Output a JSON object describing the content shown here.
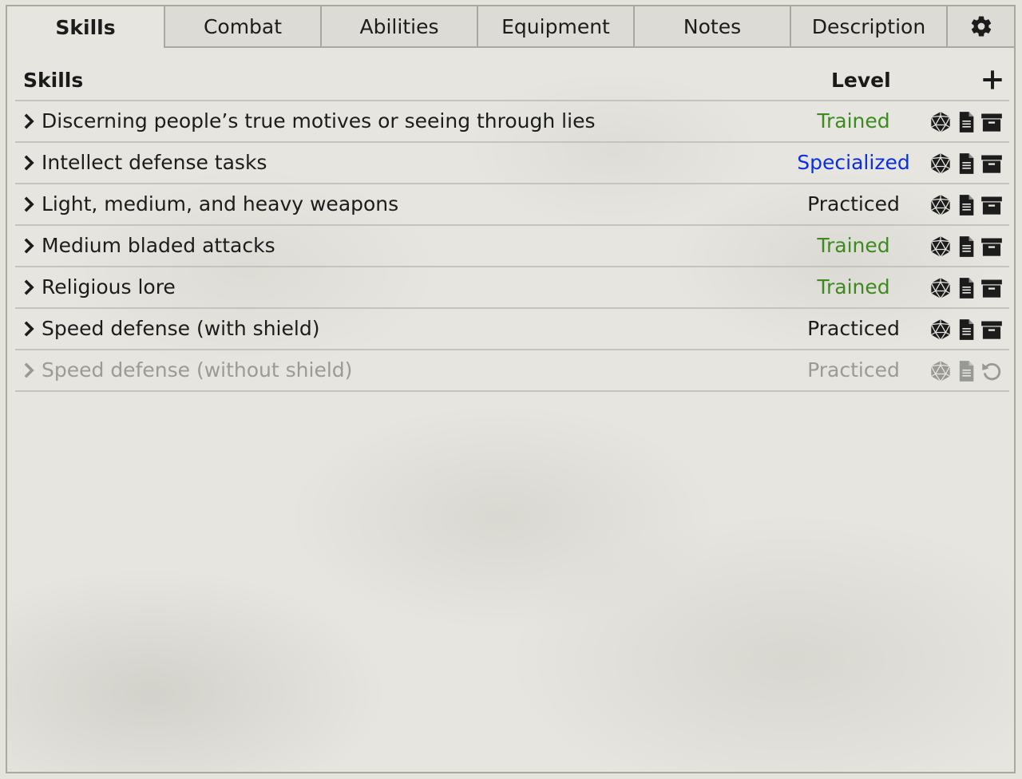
{
  "tabs": [
    {
      "label": "Skills",
      "active": true
    },
    {
      "label": "Combat",
      "active": false
    },
    {
      "label": "Abilities",
      "active": false
    },
    {
      "label": "Equipment",
      "active": false
    },
    {
      "label": "Notes",
      "active": false
    },
    {
      "label": "Description",
      "active": false
    }
  ],
  "settings_icon": "gear-icon",
  "header": {
    "skills_label": "Skills",
    "level_label": "Level",
    "add_icon": "plus-icon"
  },
  "colors": {
    "trained": "#3d8a1f",
    "specialized": "#0a2fe0",
    "practiced": "#1c1c1c",
    "disabled": "#9a9a96"
  },
  "skills": [
    {
      "name": "Discerning people’s true motives or seeing through lies",
      "level": "Trained"
    },
    {
      "name": "Intellect defense tasks",
      "level": "Specialized"
    },
    {
      "name": "Light, medium, and heavy weapons",
      "level": "Practiced"
    },
    {
      "name": "Medium bladed attacks",
      "level": "Trained"
    },
    {
      "name": "Religious lore",
      "level": "Trained"
    },
    {
      "name": "Speed defense (with shield)",
      "level": "Practiced"
    },
    {
      "name": "Speed defense (without shield)",
      "level": "Practiced",
      "archived": true
    }
  ],
  "row_icons": [
    "d20-icon",
    "document-icon",
    "archive-icon"
  ],
  "archived_row_icons": [
    "d20-icon",
    "document-icon",
    "restore-icon"
  ]
}
